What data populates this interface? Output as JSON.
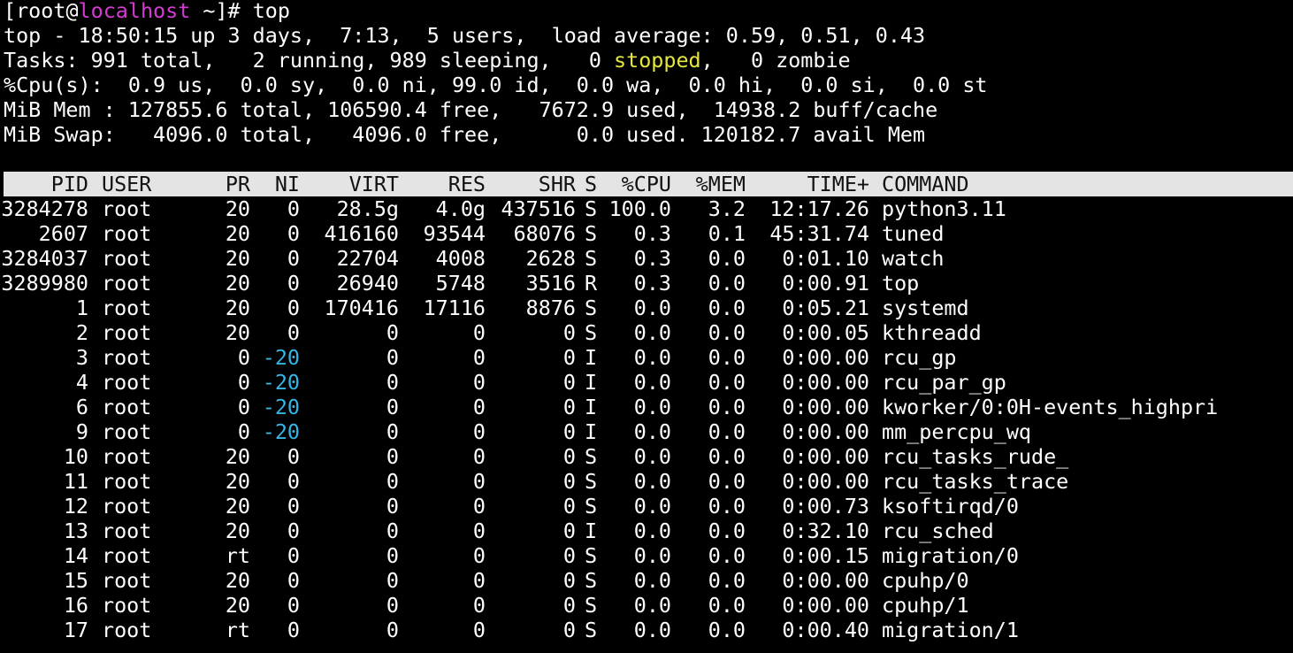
{
  "prompt": {
    "open": "[",
    "user": "root",
    "at": "@",
    "host": "localhost",
    "path": " ~]",
    "symbol": "# ",
    "command": "top"
  },
  "summary": {
    "uptime_line": "top - 18:50:15 up 3 days,  7:13,  5 users,  load average: 0.59, 0.51, 0.43",
    "tasks_prefix": "Tasks: 991 total,   2 running, 989 sleeping,   0 ",
    "tasks_stopped_word": "stopped",
    "tasks_suffix": ",   0 zombie",
    "cpu_line": "%Cpu(s):  0.9 us,  0.0 sy,  0.0 ni, 99.0 id,  0.0 wa,  0.0 hi,  0.0 si,  0.0 st",
    "mem_line": "MiB Mem : 127855.6 total, 106590.4 free,   7672.9 used,  14938.2 buff/cache",
    "swap_line": "MiB Swap:   4096.0 total,   4096.0 free,      0.0 used. 120182.7 avail Mem"
  },
  "columns": {
    "pid": "PID",
    "user": "USER",
    "pr": "PR",
    "ni": "NI",
    "virt": "VIRT",
    "res": "RES",
    "shr": "SHR",
    "s": "S",
    "cpu": "%CPU",
    "mem": "%MEM",
    "time": "TIME+",
    "command": "COMMAND"
  },
  "processes": [
    {
      "pid": "3284278",
      "user": "root",
      "pr": "20",
      "ni": "0",
      "virt": "28.5g",
      "res": "4.0g",
      "shr": "437516",
      "s": "S",
      "cpu": "100.0",
      "mem": "3.2",
      "time": "12:17.26",
      "command": "python3.11"
    },
    {
      "pid": "2607",
      "user": "root",
      "pr": "20",
      "ni": "0",
      "virt": "416160",
      "res": "93544",
      "shr": "68076",
      "s": "S",
      "cpu": "0.3",
      "mem": "0.1",
      "time": "45:31.74",
      "command": "tuned"
    },
    {
      "pid": "3284037",
      "user": "root",
      "pr": "20",
      "ni": "0",
      "virt": "22704",
      "res": "4008",
      "shr": "2628",
      "s": "S",
      "cpu": "0.3",
      "mem": "0.0",
      "time": "0:01.10",
      "command": "watch"
    },
    {
      "pid": "3289980",
      "user": "root",
      "pr": "20",
      "ni": "0",
      "virt": "26940",
      "res": "5748",
      "shr": "3516",
      "s": "R",
      "cpu": "0.3",
      "mem": "0.0",
      "time": "0:00.91",
      "command": "top"
    },
    {
      "pid": "1",
      "user": "root",
      "pr": "20",
      "ni": "0",
      "virt": "170416",
      "res": "17116",
      "shr": "8876",
      "s": "S",
      "cpu": "0.0",
      "mem": "0.0",
      "time": "0:05.21",
      "command": "systemd"
    },
    {
      "pid": "2",
      "user": "root",
      "pr": "20",
      "ni": "0",
      "virt": "0",
      "res": "0",
      "shr": "0",
      "s": "S",
      "cpu": "0.0",
      "mem": "0.0",
      "time": "0:00.05",
      "command": "kthreadd"
    },
    {
      "pid": "3",
      "user": "root",
      "pr": "0",
      "ni": "-20",
      "virt": "0",
      "res": "0",
      "shr": "0",
      "s": "I",
      "cpu": "0.0",
      "mem": "0.0",
      "time": "0:00.00",
      "command": "rcu_gp"
    },
    {
      "pid": "4",
      "user": "root",
      "pr": "0",
      "ni": "-20",
      "virt": "0",
      "res": "0",
      "shr": "0",
      "s": "I",
      "cpu": "0.0",
      "mem": "0.0",
      "time": "0:00.00",
      "command": "rcu_par_gp"
    },
    {
      "pid": "6",
      "user": "root",
      "pr": "0",
      "ni": "-20",
      "virt": "0",
      "res": "0",
      "shr": "0",
      "s": "I",
      "cpu": "0.0",
      "mem": "0.0",
      "time": "0:00.00",
      "command": "kworker/0:0H-events_highpri"
    },
    {
      "pid": "9",
      "user": "root",
      "pr": "0",
      "ni": "-20",
      "virt": "0",
      "res": "0",
      "shr": "0",
      "s": "I",
      "cpu": "0.0",
      "mem": "0.0",
      "time": "0:00.00",
      "command": "mm_percpu_wq"
    },
    {
      "pid": "10",
      "user": "root",
      "pr": "20",
      "ni": "0",
      "virt": "0",
      "res": "0",
      "shr": "0",
      "s": "S",
      "cpu": "0.0",
      "mem": "0.0",
      "time": "0:00.00",
      "command": "rcu_tasks_rude_"
    },
    {
      "pid": "11",
      "user": "root",
      "pr": "20",
      "ni": "0",
      "virt": "0",
      "res": "0",
      "shr": "0",
      "s": "S",
      "cpu": "0.0",
      "mem": "0.0",
      "time": "0:00.00",
      "command": "rcu_tasks_trace"
    },
    {
      "pid": "12",
      "user": "root",
      "pr": "20",
      "ni": "0",
      "virt": "0",
      "res": "0",
      "shr": "0",
      "s": "S",
      "cpu": "0.0",
      "mem": "0.0",
      "time": "0:00.73",
      "command": "ksoftirqd/0"
    },
    {
      "pid": "13",
      "user": "root",
      "pr": "20",
      "ni": "0",
      "virt": "0",
      "res": "0",
      "shr": "0",
      "s": "I",
      "cpu": "0.0",
      "mem": "0.0",
      "time": "0:32.10",
      "command": "rcu_sched"
    },
    {
      "pid": "14",
      "user": "root",
      "pr": "rt",
      "ni": "0",
      "virt": "0",
      "res": "0",
      "shr": "0",
      "s": "S",
      "cpu": "0.0",
      "mem": "0.0",
      "time": "0:00.15",
      "command": "migration/0"
    },
    {
      "pid": "15",
      "user": "root",
      "pr": "20",
      "ni": "0",
      "virt": "0",
      "res": "0",
      "shr": "0",
      "s": "S",
      "cpu": "0.0",
      "mem": "0.0",
      "time": "0:00.00",
      "command": "cpuhp/0"
    },
    {
      "pid": "16",
      "user": "root",
      "pr": "20",
      "ni": "0",
      "virt": "0",
      "res": "0",
      "shr": "0",
      "s": "S",
      "cpu": "0.0",
      "mem": "0.0",
      "time": "0:00.00",
      "command": "cpuhp/1"
    },
    {
      "pid": "17",
      "user": "root",
      "pr": "rt",
      "ni": "0",
      "virt": "0",
      "res": "0",
      "shr": "0",
      "s": "S",
      "cpu": "0.0",
      "mem": "0.0",
      "time": "0:00.40",
      "command": "migration/1"
    }
  ],
  "colors": {
    "background": "#000000",
    "text": "#ffffff",
    "hostname": "#d33bd3",
    "stopped": "#e6e63c",
    "negative_nice": "#35b5e6",
    "header_bar": "#e4e4e4",
    "header_text": "#111111"
  }
}
